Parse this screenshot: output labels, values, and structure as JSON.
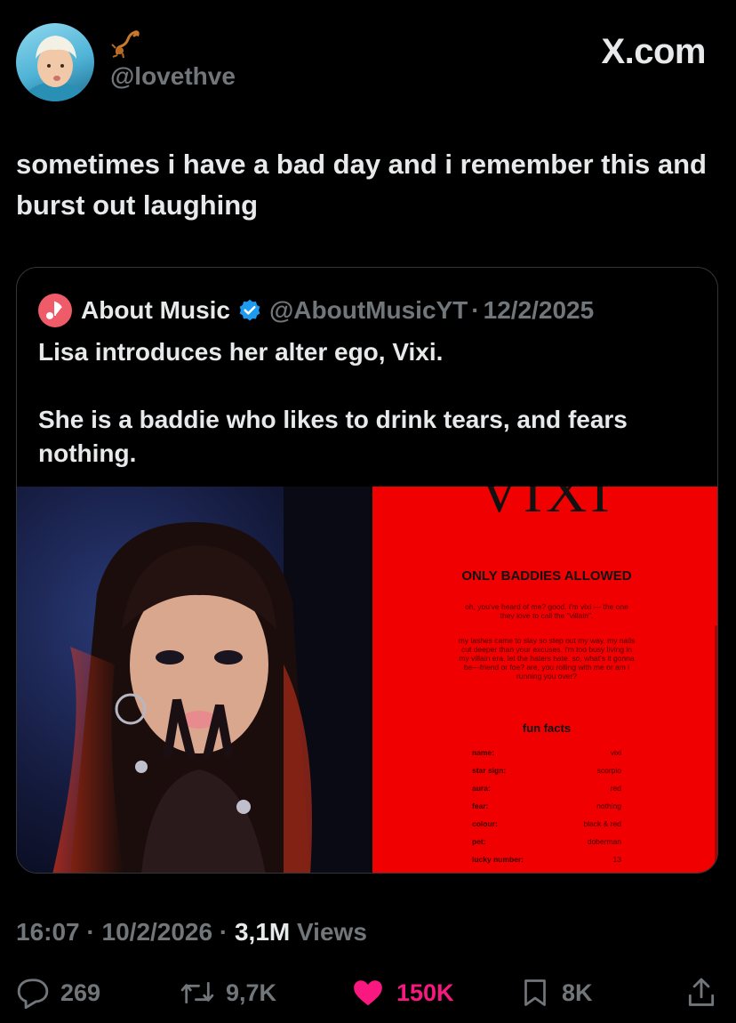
{
  "author": {
    "handle": "@lovethve",
    "emoji_icon": "scorpion-icon"
  },
  "brand": "X.com",
  "tweet_text": "sometimes i have a bad day and i remember this and burst out laughing",
  "quoted": {
    "name": "About Music",
    "handle": "@AboutMusicYT",
    "separator": "·",
    "date": "12/2/2025",
    "text": "Lisa introduces her alter ego, Vixi.\n\nShe is a baddie who likes to drink tears, and fears nothing.",
    "poster": {
      "title": "VIXI",
      "headline": "ONLY BADDIES ALLOWED",
      "intro": "oh, you've heard of me? good. i'm vixi — the one they love to call the \"villain\".",
      "body": "my lashes came to slay so step out my way, my nails cut deeper than your excuses. i'm too busy living in my villain era, let the haters hate. so, what's it gonna be—friend or foe? are, you rolling with me or am i running you over?",
      "fun_facts_title": "fun facts",
      "facts": [
        {
          "label": "name:",
          "value": "vixi"
        },
        {
          "label": "star sign:",
          "value": "scorpio"
        },
        {
          "label": "aura:",
          "value": "red"
        },
        {
          "label": "fear:",
          "value": "nothing"
        },
        {
          "label": "colour:",
          "value": "black & red"
        },
        {
          "label": "pet:",
          "value": "doberman"
        },
        {
          "label": "lucky number:",
          "value": "13"
        }
      ]
    }
  },
  "meta": {
    "time": "16:07",
    "date": "10/2/2026",
    "views": "3,1M",
    "views_label": "Views"
  },
  "actions": {
    "replies": "269",
    "reposts": "9,7K",
    "likes": "150K",
    "bookmarks": "8K"
  },
  "colors": {
    "like": "#f91880",
    "verified": "#1d9bf0",
    "poster_bg": "#f00000"
  }
}
